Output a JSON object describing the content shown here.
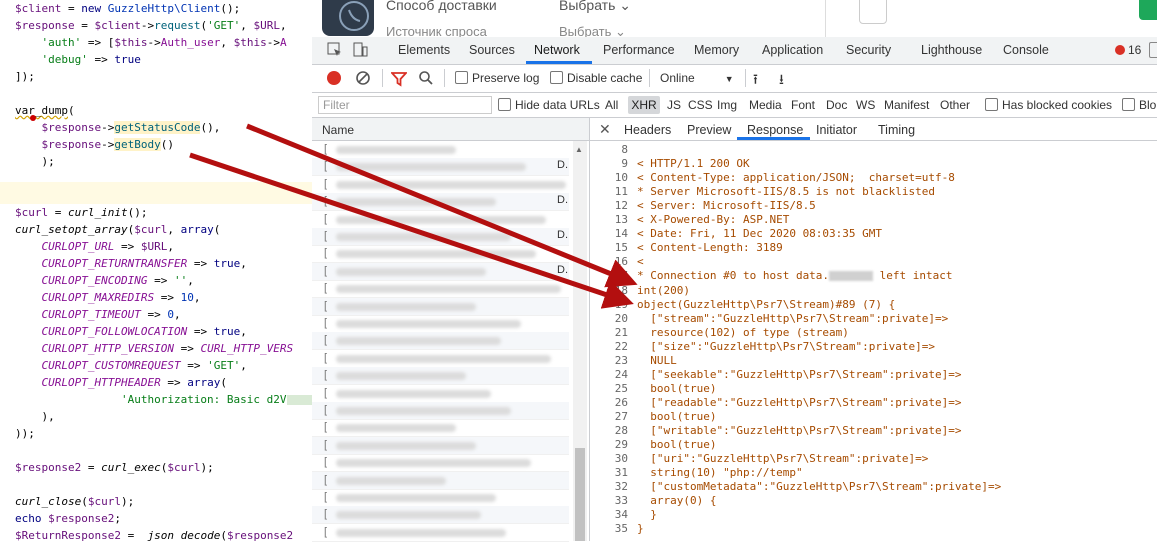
{
  "editor": {
    "lines": [
      {
        "t1": "$client = new ",
        "t2": "GuzzleHttp\\Client",
        "t3": "();"
      },
      {
        "t1": "$response = $client->",
        "t2": "request",
        "t3": "('GET', $URL,"
      },
      {
        "t1": "    'auth' => [$this->Auth_user, $this->A"
      },
      {
        "t1": "    'debug' => true"
      },
      {
        "t1": "]);"
      },
      {
        "t1": "var_dump("
      },
      {
        "t1": "    $response->getStatusCode(),"
      },
      {
        "t1": "    $response->getBody()"
      },
      {
        "t1": "    );"
      },
      {
        "t1": "$curl = curl_init();"
      },
      {
        "t1": "curl_setopt_array($curl, array("
      },
      {
        "t1": "    CURLOPT_URL => $URL,"
      },
      {
        "t1": "    CURLOPT_RETURNTRANSFER => true,"
      },
      {
        "t1": "    CURLOPT_ENCODING => '',"
      },
      {
        "t1": "    CURLOPT_MAXREDIRS => 10,"
      },
      {
        "t1": "    CURLOPT_TIMEOUT => 0,"
      },
      {
        "t1": "    CURLOPT_FOLLOWLOCATION => true,"
      },
      {
        "t1": "    CURLOPT_HTTP_VERSION => CURL_HTTP_VERS"
      },
      {
        "t1": "    CURLOPT_CUSTOMREQUEST => 'GET',"
      },
      {
        "t1": "    CURLOPT_HTTPHEADER => array("
      },
      {
        "t1": "        'Authorization: Basic d2V",
        "t2": "9t"
      },
      {
        "t1": "    ),"
      },
      {
        "t1": "));"
      },
      {
        "t1": "$response2 = curl_exec($curl);"
      },
      {
        "t1": "curl_close($curl);"
      },
      {
        "t1": "echo $response2;"
      },
      {
        "t1": "$ReturnResponse2 =  json_decode($response2"
      }
    ]
  },
  "page": {
    "delivery": "Способ доставки",
    "select1": "Выбрать",
    "sources": "Источник спроса",
    "select2": "Выбрать"
  },
  "devtools": {
    "tabs": [
      "Elements",
      "Sources",
      "Network",
      "Performance",
      "Memory",
      "Application",
      "Security",
      "Lighthouse",
      "Console"
    ],
    "active_tab": "Network",
    "error_count": "16",
    "toolbar": {
      "preserve_log": "Preserve log",
      "disable_cache": "Disable cache",
      "throttle": "Online"
    },
    "filter": {
      "placeholder": "Filter",
      "hide_data_urls": "Hide data URLs",
      "types": [
        "All",
        "XHR",
        "JS",
        "CSS",
        "Img",
        "Media",
        "Font",
        "Doc",
        "WS",
        "Manifest",
        "Other"
      ],
      "active_type": "XHR",
      "has_blocked": "Has blocked cookies",
      "blocked_requests": "Blo"
    },
    "name_header": "Name",
    "detail_tabs": [
      "Headers",
      "Preview",
      "Response",
      "Initiator",
      "Timing"
    ],
    "active_detail_tab": "Response",
    "response_lines": [
      {
        "n": "8",
        "t": ""
      },
      {
        "n": "9",
        "t": "< HTTP/1.1 200 OK"
      },
      {
        "n": "10",
        "t": "< Content-Type: application/JSON;  charset=utf-8"
      },
      {
        "n": "11",
        "t": "* Server Microsoft-IIS/8.5 is not blacklisted"
      },
      {
        "n": "12",
        "t": "< Server: Microsoft-IIS/8.5"
      },
      {
        "n": "13",
        "t": "< X-Powered-By: ASP.NET"
      },
      {
        "n": "14",
        "t": "< Date: Fri, 11 Dec 2020 08:03:35 GMT"
      },
      {
        "n": "15",
        "t": "< Content-Length: 3189"
      },
      {
        "n": "16",
        "t": "<"
      },
      {
        "n": "17",
        "t": "* Connection #0 to host data.",
        "t2": " left intact"
      },
      {
        "n": "18",
        "t": "int(200)"
      },
      {
        "n": "19",
        "t": "object(GuzzleHttp\\Psr7\\Stream)#89 (7) {"
      },
      {
        "n": "20",
        "t": "  [\"stream\":\"GuzzleHttp\\Psr7\\Stream\":private]=>"
      },
      {
        "n": "21",
        "t": "  resource(102) of type (stream)"
      },
      {
        "n": "22",
        "t": "  [\"size\":\"GuzzleHttp\\Psr7\\Stream\":private]=>"
      },
      {
        "n": "23",
        "t": "  NULL"
      },
      {
        "n": "24",
        "t": "  [\"seekable\":\"GuzzleHttp\\Psr7\\Stream\":private]=>"
      },
      {
        "n": "25",
        "t": "  bool(true)"
      },
      {
        "n": "26",
        "t": "  [\"readable\":\"GuzzleHttp\\Psr7\\Stream\":private]=>"
      },
      {
        "n": "27",
        "t": "  bool(true)"
      },
      {
        "n": "28",
        "t": "  [\"writable\":\"GuzzleHttp\\Psr7\\Stream\":private]=>"
      },
      {
        "n": "29",
        "t": "  bool(true)"
      },
      {
        "n": "30",
        "t": "  [\"uri\":\"GuzzleHttp\\Psr7\\Stream\":private]=>"
      },
      {
        "n": "31",
        "t": "  string(10) \"php://temp\""
      },
      {
        "n": "32",
        "t": "  [\"customMetadata\":\"GuzzleHttp\\Psr7\\Stream\":private]=>"
      },
      {
        "n": "33",
        "t": "  array(0) {"
      },
      {
        "n": "34",
        "t": "  }"
      },
      {
        "n": "35",
        "t": "}"
      }
    ]
  },
  "colors": {
    "arrow": "#b30f0f",
    "accent": "#1a73e8",
    "record": "#d93025"
  }
}
